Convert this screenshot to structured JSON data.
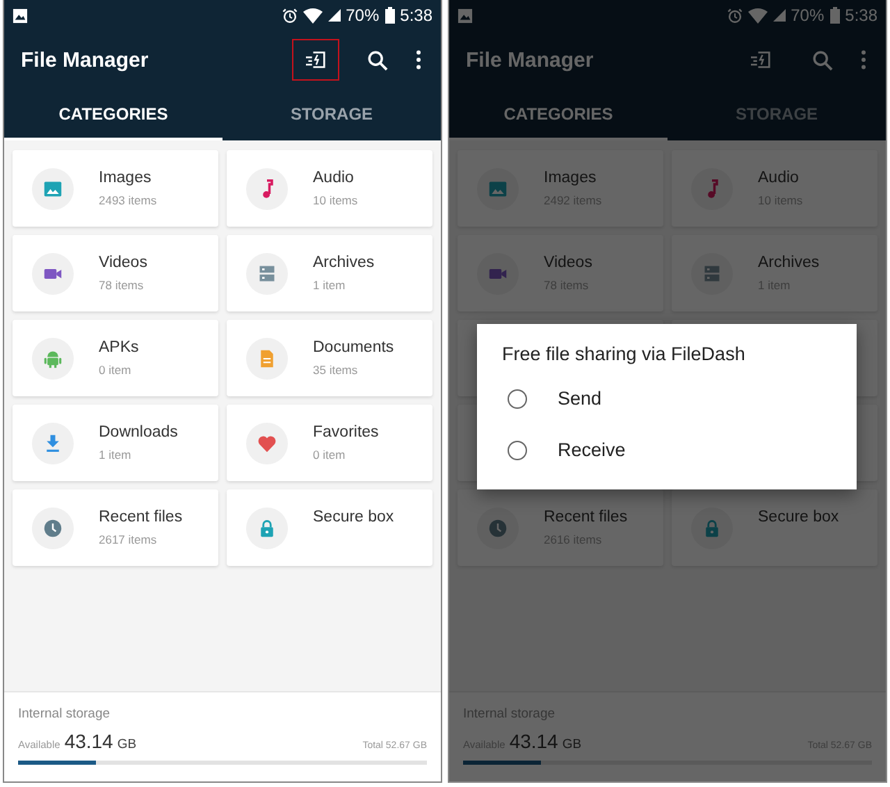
{
  "screens": [
    {
      "status_bar": {
        "battery": "70%",
        "time": "5:38"
      },
      "app_bar": {
        "title": "File Manager",
        "share_highlighted": true
      },
      "tabs": [
        {
          "label": "CATEGORIES",
          "selected": true
        },
        {
          "label": "STORAGE",
          "selected": false
        }
      ],
      "categories": [
        {
          "kind": "images",
          "name": "Images",
          "count": "2493 items"
        },
        {
          "kind": "audio",
          "name": "Audio",
          "count": "10 items"
        },
        {
          "kind": "videos",
          "name": "Videos",
          "count": "78 items"
        },
        {
          "kind": "archives",
          "name": "Archives",
          "count": "1 item"
        },
        {
          "kind": "apk",
          "name": "APKs",
          "count": "0 item"
        },
        {
          "kind": "documents",
          "name": "Documents",
          "count": "35 items"
        },
        {
          "kind": "downloads",
          "name": "Downloads",
          "count": "1 item"
        },
        {
          "kind": "favorites",
          "name": "Favorites",
          "count": "0 item"
        },
        {
          "kind": "recent",
          "name": "Recent files",
          "count": "2617 items"
        },
        {
          "kind": "secure",
          "name": "Secure box"
        }
      ],
      "storage": {
        "label": "Internal storage",
        "available_label": "Available",
        "available": "43.14",
        "unit": "GB",
        "total": "Total 52.67 GB",
        "level": 0.19
      }
    },
    {
      "status_bar": {
        "battery": "70%",
        "time": "5:38"
      },
      "app_bar": {
        "title": "File Manager",
        "share_highlighted": false
      },
      "tabs": [
        {
          "label": "CATEGORIES",
          "selected": true
        },
        {
          "label": "STORAGE",
          "selected": false
        }
      ],
      "categories": [
        {
          "kind": "images",
          "name": "Images",
          "count": "2492 items"
        },
        {
          "kind": "audio",
          "name": "Audio",
          "count": "10 items"
        },
        {
          "kind": "videos",
          "name": "Videos",
          "count": "78 items"
        },
        {
          "kind": "archives",
          "name": "Archives",
          "count": "1 item"
        },
        {
          "kind": "covered"
        },
        {
          "kind": "covered"
        },
        {
          "kind": "covered"
        },
        {
          "kind": "covered"
        },
        {
          "kind": "recent",
          "name": "Recent files",
          "count": "2616 items"
        },
        {
          "kind": "secure",
          "name": "Secure box"
        }
      ],
      "storage": {
        "label": "Internal storage",
        "available_label": "Available",
        "available": "43.14",
        "unit": "GB",
        "total": "Total 52.67 GB",
        "level": 0.19
      },
      "dialog": {
        "title": "Free file sharing via FileDash",
        "options": [
          {
            "label": "Send",
            "selected": false
          },
          {
            "label": "Receive",
            "selected": false
          }
        ]
      }
    }
  ]
}
